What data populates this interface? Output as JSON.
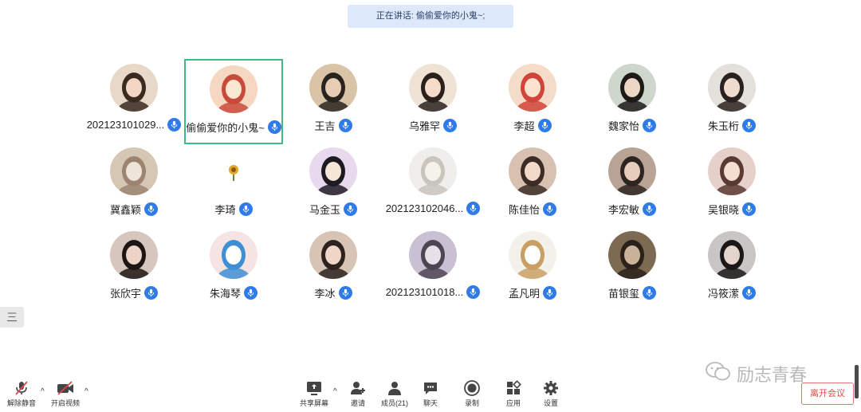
{
  "speaking": {
    "label": "正在讲话: 偷偷爱你的小鬼~;"
  },
  "participants": [
    {
      "name": "202123101029...",
      "palette": [
        "#e8d8c8",
        "#3a2a20",
        "#f3d6c4"
      ],
      "active": false
    },
    {
      "name": "偷偷爱你的小鬼~",
      "palette": [
        "#f6d7c2",
        "#c84a3a",
        "#fbe6d2"
      ],
      "active": true
    },
    {
      "name": "王吉",
      "palette": [
        "#d9c4a8",
        "#2a2420",
        "#e8cdb5"
      ],
      "active": false
    },
    {
      "name": "乌雅罕",
      "palette": [
        "#efe3d6",
        "#2b221e",
        "#f5dccb"
      ],
      "active": false
    },
    {
      "name": "李超",
      "palette": [
        "#f4dcc8",
        "#d0443a",
        "#fbe3cf"
      ],
      "active": false
    },
    {
      "name": "魏家怡",
      "palette": [
        "#cfd6cc",
        "#1d1a18",
        "#ecd6c6"
      ],
      "active": false
    },
    {
      "name": "朱玉桁",
      "palette": [
        "#e4e0dc",
        "#2a2220",
        "#f0dccf"
      ],
      "active": false
    },
    {
      "name": "冀鑫颖",
      "palette": [
        "#d6c7b5",
        "#9b8570",
        "#efe4d8"
      ],
      "active": false
    },
    {
      "name": "李琦",
      "palette": [
        "#ffffff",
        "#e3a72a",
        "#6a8a3a"
      ],
      "active": false,
      "small": true
    },
    {
      "name": "马金玉",
      "palette": [
        "#e9d9ef",
        "#1e1a22",
        "#f6e6d8"
      ],
      "active": false
    },
    {
      "name": "202123102046...",
      "palette": [
        "#efeeea",
        "#c9c4bc",
        "#f5f2ec"
      ],
      "active": false
    },
    {
      "name": "陈佳怡",
      "palette": [
        "#d9c1b2",
        "#3b2c25",
        "#f1d8c8"
      ],
      "active": false
    },
    {
      "name": "李宏敏",
      "palette": [
        "#b9a394",
        "#2e2420",
        "#e6cdbe"
      ],
      "active": false
    },
    {
      "name": "吴银晓",
      "palette": [
        "#e5d1c9",
        "#5a3a32",
        "#f4ddd1"
      ],
      "active": false
    },
    {
      "name": "张欣宇",
      "palette": [
        "#d7c6bd",
        "#1c1614",
        "#ecd4c6"
      ],
      "active": false
    },
    {
      "name": "朱海琴",
      "palette": [
        "#f6e3e4",
        "#3f8fd6",
        "#ffffff"
      ],
      "active": false
    },
    {
      "name": "李冰",
      "palette": [
        "#d8c4b4",
        "#2c221e",
        "#f0d6c6"
      ],
      "active": false
    },
    {
      "name": "202123101018...",
      "palette": [
        "#c9c0d3",
        "#4d4552",
        "#e9dfe8"
      ],
      "active": false
    },
    {
      "name": "孟凡明",
      "palette": [
        "#f4f1ea",
        "#c8a065",
        "#ffffff"
      ],
      "active": false
    },
    {
      "name": "苗银玺",
      "palette": [
        "#7c6a52",
        "#2a211a",
        "#c9b29a"
      ],
      "active": false
    },
    {
      "name": "冯筱潆",
      "palette": [
        "#c9c5c2",
        "#1a1716",
        "#e4d5cc"
      ],
      "active": false
    }
  ],
  "toolbar": {
    "unmute": "解除静音",
    "start_video": "开启视频",
    "share_screen": "共享屏幕",
    "invite": "邀请",
    "members": "成员(21)",
    "chat": "聊天",
    "record": "录制",
    "apps": "应用",
    "settings": "设置",
    "leave": "离开会议"
  },
  "side_handle": {
    "label": "三"
  },
  "watermark": {
    "text": "励志青春"
  },
  "colors": {
    "mic_blue": "#2f7bea",
    "active_border": "#3dbb87",
    "leave_red": "#e04848",
    "banner_bg": "#dde9fb"
  }
}
